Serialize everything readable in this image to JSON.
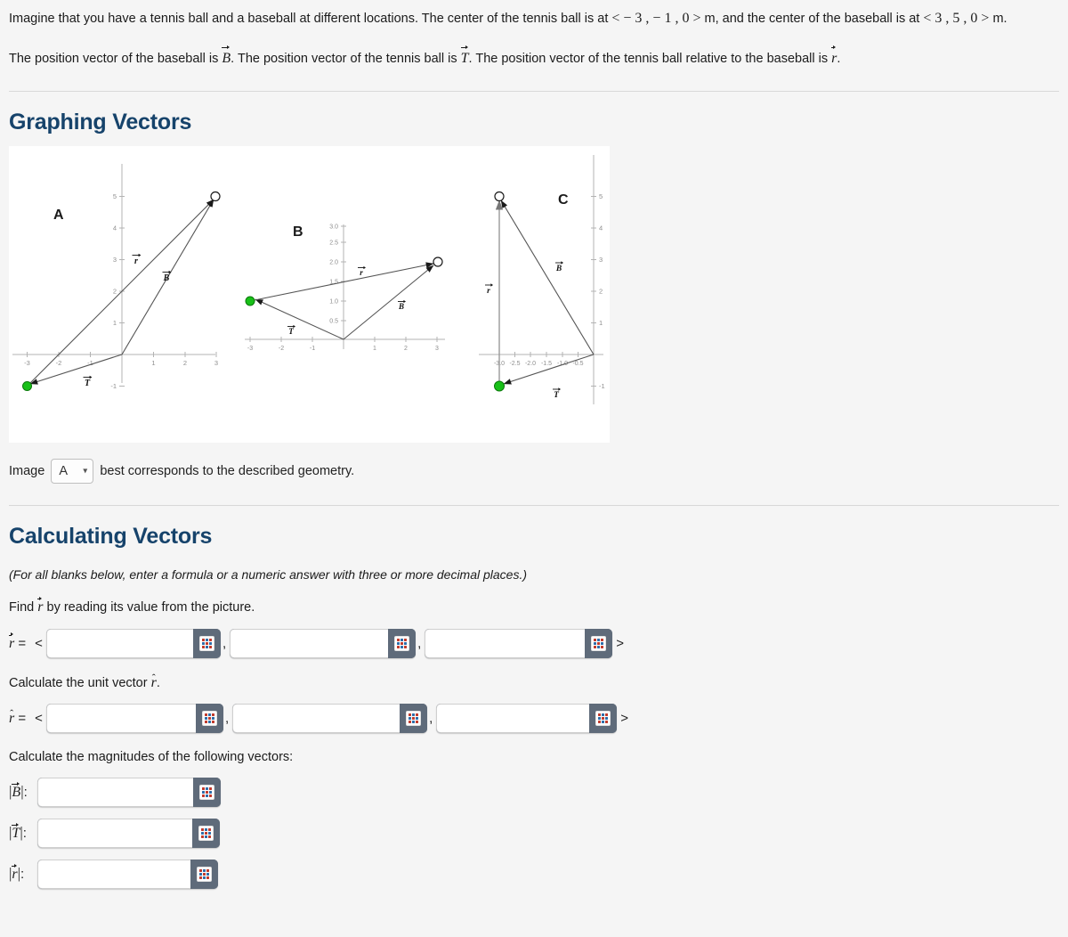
{
  "problem": {
    "line1_part1": "Imagine that you have a tennis ball and a baseball at different locations. The center of the tennis ball is at ",
    "tennis_coords": "− 3 , − 1 , 0",
    "line1_part2": " m, and the center of the baseball is at ",
    "baseball_coords": "3 , 5 , 0",
    "line1_part3": " m.",
    "line2_part1": "The position vector of the baseball is ",
    "vec_B": "B",
    "line2_part2": ". The position vector of the tennis ball is ",
    "vec_T": "T",
    "line2_part3": ". The position vector of the tennis ball relative to the baseball is ",
    "vec_r": "r",
    "line2_part4": "."
  },
  "sections": {
    "graphing_title": "Graphing Vectors",
    "calculating_title": "Calculating Vectors"
  },
  "image_select": {
    "prefix": "Image",
    "selected": "A",
    "options": [
      "A",
      "B",
      "C"
    ],
    "suffix": "best corresponds to the described geometry."
  },
  "calculating": {
    "note": "(For all blanks below, enter a formula or a numeric answer with three or more decimal places.)",
    "find_r_text_pre": "Find ",
    "find_r_text_post": " by reading its value from the picture.",
    "unit_vector_pre": "Calculate the unit vector ",
    "unit_vector_post": ".",
    "magnitudes_text": "Calculate the magnitudes of the following vectors:",
    "r_label_pre": " = ",
    "angle_open": "<",
    "angle_close": ">",
    "comma": ",",
    "keypad_icon": "keypad-icon",
    "r_values": [
      "",
      "",
      ""
    ],
    "rhat_values": [
      "",
      "",
      ""
    ],
    "magnitude_rows": [
      {
        "label": "B",
        "value": ""
      },
      {
        "label": "T",
        "value": ""
      },
      {
        "label": "r",
        "value": ""
      }
    ]
  },
  "chart_data": [
    {
      "type": "scatter",
      "title": "A",
      "xlabel": "",
      "ylabel": "",
      "xlim": [
        -3.4,
        3.4
      ],
      "ylim": [
        -1.3,
        5.3
      ],
      "xticks": [
        -3,
        -2,
        -1,
        1,
        2,
        3
      ],
      "yticks": [
        1,
        2,
        3,
        4,
        5,
        -1
      ],
      "grid": false,
      "points": [
        {
          "name": "tennis-ball",
          "x": -3,
          "y": -1,
          "marker": "filled-green-circle"
        },
        {
          "name": "baseball",
          "x": 3,
          "y": 5,
          "marker": "open-circle"
        }
      ],
      "vectors": [
        {
          "label": "T",
          "from": [
            0,
            0
          ],
          "to": [
            -3,
            -1
          ],
          "label_at": [
            -1.35,
            -0.62
          ]
        },
        {
          "label": "B",
          "from": [
            0,
            0
          ],
          "to": [
            3,
            5
          ],
          "label_at": [
            1.55,
            2.45
          ]
        },
        {
          "label": "r",
          "from": [
            -3,
            -1
          ],
          "to": [
            3,
            5
          ],
          "label_at": [
            0.35,
            3.0
          ]
        }
      ]
    },
    {
      "type": "scatter",
      "title": "B",
      "xlabel": "",
      "ylabel": "",
      "xlim": [
        -3.4,
        3.4
      ],
      "ylim": [
        -0.35,
        3.15
      ],
      "xticks": [
        -3,
        -2,
        -1,
        1,
        2,
        3
      ],
      "yticks": [
        0.5,
        1.0,
        1.5,
        2.0,
        2.5,
        3.0
      ],
      "ytick_labels": [
        "0.5",
        "1.0",
        "1.5",
        "2.0",
        "2.5",
        "3.0"
      ],
      "grid": false,
      "points": [
        {
          "name": "tennis-ball",
          "x": -3,
          "y": 1,
          "marker": "filled-green-circle"
        },
        {
          "name": "baseball",
          "x": 3,
          "y": 2,
          "marker": "open-circle"
        }
      ],
      "vectors": [
        {
          "label": "T",
          "from": [
            0,
            0
          ],
          "to": [
            -3,
            1
          ],
          "label_at": [
            -1.75,
            0.38
          ]
        },
        {
          "label": "B",
          "from": [
            0,
            0
          ],
          "to": [
            3,
            2
          ],
          "label_at": [
            1.6,
            0.92
          ]
        },
        {
          "label": "r",
          "from": [
            -3,
            1
          ],
          "to": [
            3,
            2
          ],
          "label_at": [
            0.4,
            1.95
          ]
        }
      ]
    },
    {
      "type": "scatter",
      "title": "C",
      "xlabel": "",
      "ylabel": "",
      "xlim": [
        -3.25,
        0.3
      ],
      "ylim": [
        -1.3,
        5.3
      ],
      "xticks": [
        -3.0,
        -2.5,
        -2.0,
        -1.5,
        -1.0,
        -0.5
      ],
      "xtick_labels": [
        "-3.0",
        "-2.5",
        "-2.0",
        "-1.5",
        "-1.0",
        "-0.5"
      ],
      "yticks": [
        1,
        2,
        3,
        4,
        5,
        -1
      ],
      "grid": false,
      "points": [
        {
          "name": "tennis-ball",
          "x": -3,
          "y": -1,
          "marker": "filled-green-circle"
        },
        {
          "name": "baseball",
          "x": -3,
          "y": 5,
          "marker": "open-circle"
        }
      ],
      "vectors": [
        {
          "label": "T",
          "from": [
            0,
            0
          ],
          "to": [
            -3,
            -1
          ],
          "label_at": [
            -1.45,
            -0.58
          ]
        },
        {
          "label": "B",
          "from": [
            0,
            0
          ],
          "to": [
            -3,
            5
          ],
          "label_at": [
            -1.35,
            2.6
          ]
        },
        {
          "label": "r",
          "from": [
            -3,
            -1
          ],
          "to": [
            -3,
            5
          ],
          "label_at": [
            -2.75,
            2.0
          ]
        }
      ]
    }
  ]
}
